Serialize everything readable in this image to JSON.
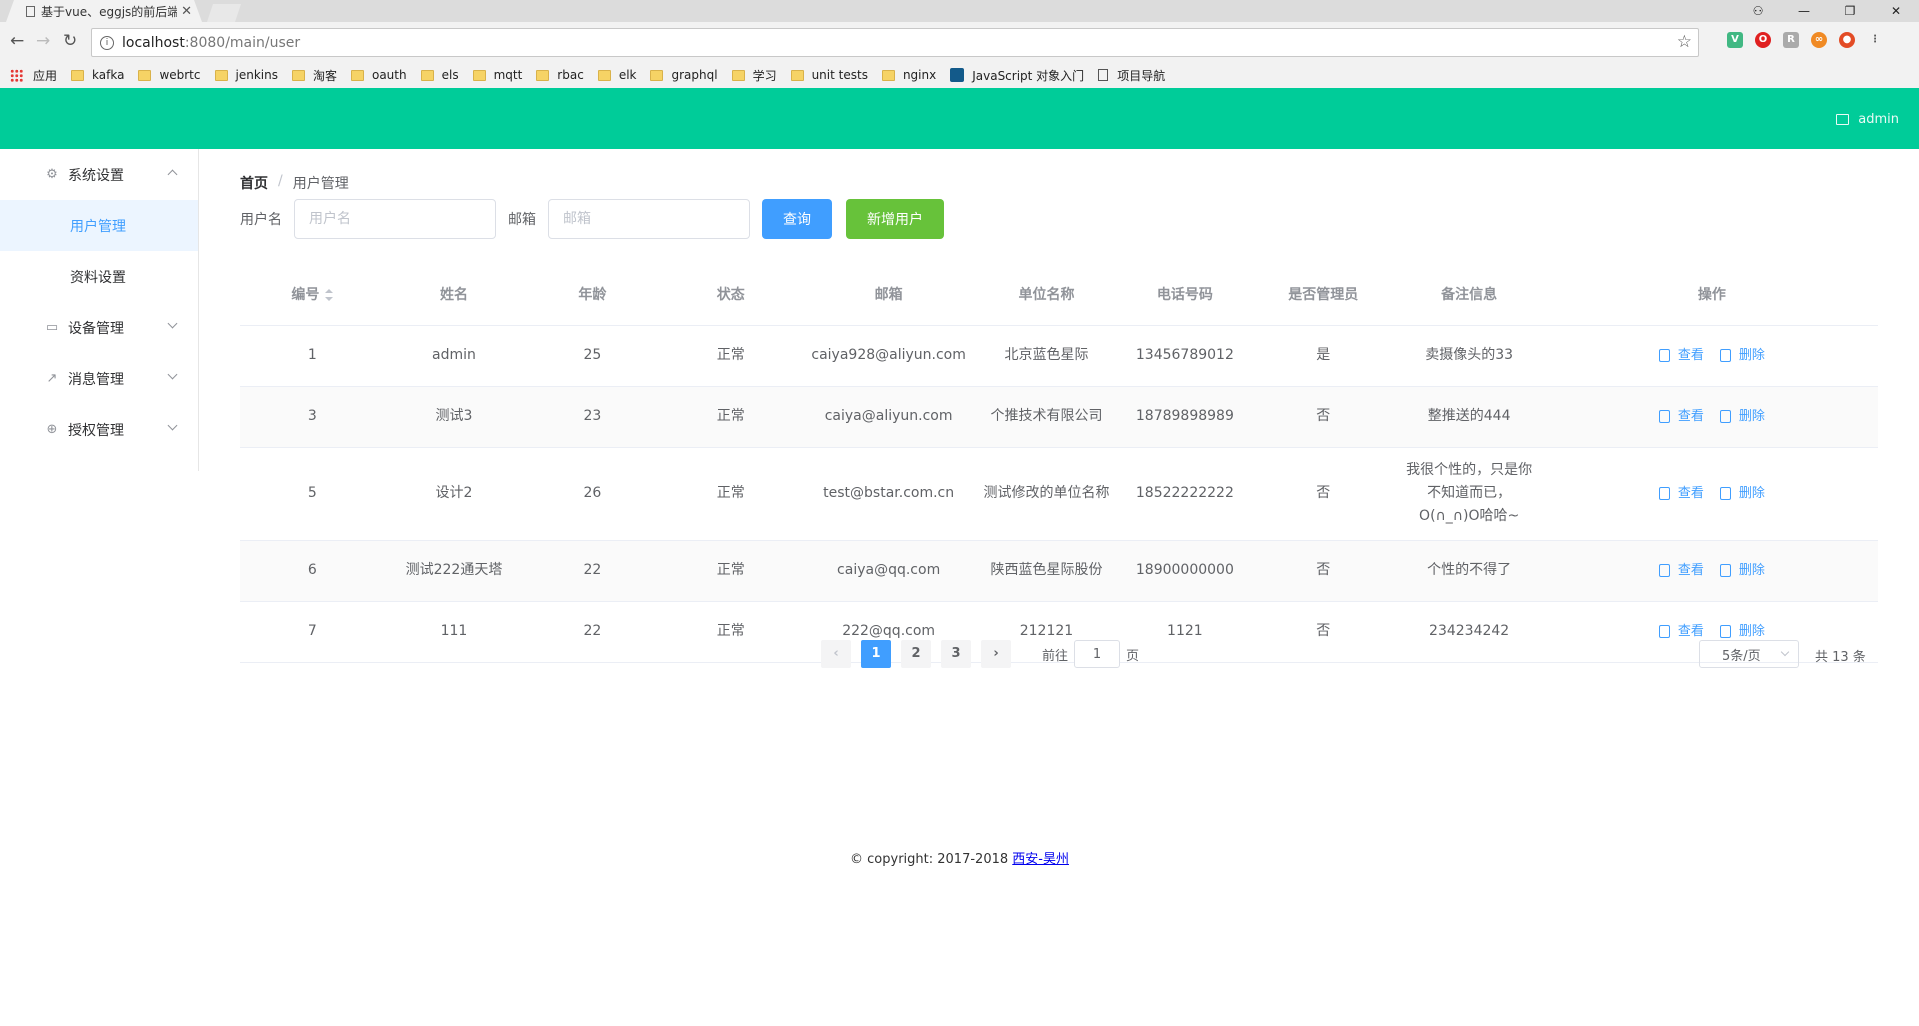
{
  "browser": {
    "tab_title": "基于vue、eggjs的前后端",
    "close_glyph": "✕",
    "window_controls": [
      "⚇",
      "—",
      "❐",
      "✕"
    ],
    "url_host": "localhost",
    "url_path": ":8080/main/user",
    "bookmarks": [
      {
        "label": "应用",
        "icon": "apps-icon"
      },
      {
        "label": "kafka",
        "icon": "folder-icon"
      },
      {
        "label": "webrtc",
        "icon": "folder-icon"
      },
      {
        "label": "jenkins",
        "icon": "folder-icon"
      },
      {
        "label": "淘客",
        "icon": "folder-icon"
      },
      {
        "label": "oauth",
        "icon": "folder-icon"
      },
      {
        "label": "els",
        "icon": "folder-icon"
      },
      {
        "label": "mqtt",
        "icon": "folder-icon"
      },
      {
        "label": "rbac",
        "icon": "folder-icon"
      },
      {
        "label": "elk",
        "icon": "folder-icon"
      },
      {
        "label": "graphql",
        "icon": "folder-icon"
      },
      {
        "label": "学习",
        "icon": "folder-icon"
      },
      {
        "label": "unit tests",
        "icon": "folder-icon"
      },
      {
        "label": "nginx",
        "icon": "folder-icon"
      },
      {
        "label": "JavaScript 对象入门",
        "icon": "js-icon"
      },
      {
        "label": "项目导航",
        "icon": "page-icon"
      }
    ]
  },
  "header": {
    "username": "admin",
    "color": "#00cc99"
  },
  "sidebar": {
    "menus": [
      {
        "label": "系统设置",
        "icon": "gear-icon",
        "expanded": true,
        "children": [
          {
            "label": "用户管理",
            "active": true
          },
          {
            "label": "资料设置",
            "active": false
          }
        ]
      },
      {
        "label": "设备管理",
        "icon": "device-icon",
        "expanded": false
      },
      {
        "label": "消息管理",
        "icon": "chart-icon",
        "expanded": false
      },
      {
        "label": "授权管理",
        "icon": "globe-icon",
        "expanded": false
      }
    ]
  },
  "breadcrumb": {
    "home": "首页",
    "separator": "/",
    "current": "用户管理"
  },
  "search": {
    "username_label": "用户名",
    "username_placeholder": "用户名",
    "email_label": "邮箱",
    "email_placeholder": "邮箱",
    "query_button": "查询",
    "add_button": "新增用户"
  },
  "table": {
    "columns": [
      "编号",
      "姓名",
      "年龄",
      "状态",
      "邮箱",
      "单位名称",
      "电话号码",
      "是否管理员",
      "备注信息",
      "操作"
    ],
    "view_label": "查看",
    "delete_label": "删除",
    "rows": [
      {
        "id": "1",
        "name": "admin",
        "age": "25",
        "status": "正常",
        "email": "caiya928@aliyun.com",
        "company": "北京蓝色星际",
        "phone": "13456789012",
        "admin": "是",
        "remark": "卖摄像头的33"
      },
      {
        "id": "3",
        "name": "测试3",
        "age": "23",
        "status": "正常",
        "email": "caiya@aliyun.com",
        "company": "个推技术有限公司",
        "phone": "18789898989",
        "admin": "否",
        "remark": "整推送的444"
      },
      {
        "id": "5",
        "name": "设计2",
        "age": "26",
        "status": "正常",
        "email": "test@bstar.com.cn",
        "company": "测试修改的单位名称",
        "phone": "18522222222",
        "admin": "否",
        "remark": "我很个性的，只是你不知道而已，O(∩_∩)O哈哈~"
      },
      {
        "id": "6",
        "name": "测试222通天塔",
        "age": "22",
        "status": "正常",
        "email": "caiya@qq.com",
        "company": "陕西蓝色星际股份",
        "phone": "18900000000",
        "admin": "否",
        "remark": "个性的不得了"
      },
      {
        "id": "7",
        "name": "111",
        "age": "22",
        "status": "正常",
        "email": "222@qq.com",
        "company": "212121",
        "phone": "1121",
        "admin": "否",
        "remark": "234234242"
      }
    ]
  },
  "pagination": {
    "prev": "‹",
    "next": "›",
    "pages": [
      "1",
      "2",
      "3"
    ],
    "current_page": "1",
    "goto_label": "前往",
    "goto_value": "1",
    "page_suffix": "页",
    "page_size": "5条/页",
    "total": "共 13 条"
  },
  "footer": {
    "copyright": "© copyright: 2017-2018 ",
    "link": "西安-昊州"
  }
}
